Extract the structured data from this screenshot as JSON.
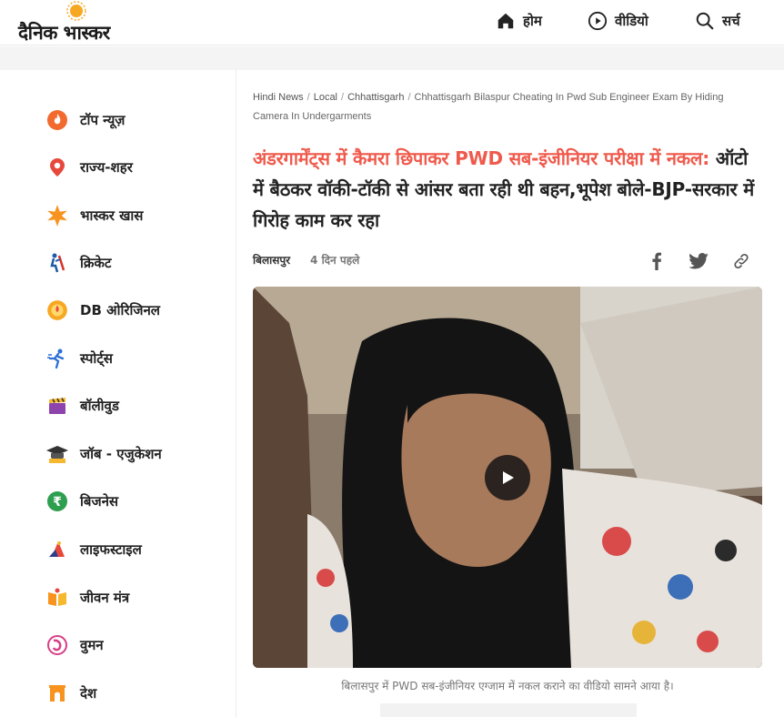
{
  "header": {
    "logo_text": "दैनिक भास्कर",
    "nav": [
      {
        "label": "होम",
        "icon": "home-icon"
      },
      {
        "label": "वीडियो",
        "icon": "play-circle-icon"
      },
      {
        "label": "सर्च",
        "icon": "search-icon"
      }
    ]
  },
  "sidebar": {
    "items": [
      {
        "label": "टॉप न्यूज़",
        "icon": "flame-icon"
      },
      {
        "label": "राज्य-शहर",
        "icon": "location-pin-icon"
      },
      {
        "label": "भास्कर खास",
        "icon": "star-burst-icon"
      },
      {
        "label": "क्रिकेट",
        "icon": "cricket-player-icon"
      },
      {
        "label": "DB ओरिजिनल",
        "icon": "diya-icon"
      },
      {
        "label": "स्पोर्ट्स",
        "icon": "runner-icon"
      },
      {
        "label": "बॉलीवुड",
        "icon": "clapperboard-icon"
      },
      {
        "label": "जॉब - एजुकेशन",
        "icon": "graduation-cap-icon"
      },
      {
        "label": "बिजनेस",
        "icon": "rupee-icon"
      },
      {
        "label": "लाइफस्टाइल",
        "icon": "lifestyle-icon"
      },
      {
        "label": "जीवन मंत्र",
        "icon": "book-icon"
      },
      {
        "label": "वुमन",
        "icon": "woman-icon"
      },
      {
        "label": "देश",
        "icon": "india-gate-icon"
      }
    ]
  },
  "article": {
    "breadcrumb": [
      "Hindi News",
      "Local",
      "Chhattisgarh"
    ],
    "breadcrumb_current": "Chhattisgarh Bilaspur Cheating In Pwd Sub Engineer Exam By Hiding Camera In Undergarments",
    "headline_kicker": "अंडरगार्मेंट्स में कैमरा छिपाकर PWD सब-इंजीनियर परीक्षा में नकल:",
    "headline_rest": " ऑटो में बैठकर वॉकी-टॉकी से आंसर बता रही थी बहन,भूपेश बोले-BJP-सरकार में गिरोह काम कर रहा",
    "city": "बिलासपुर",
    "time": "4 दिन पहले",
    "video_caption": "बिलासपुर में PWD सब-इंजीनियर एग्जाम में नकल कराने का वीडियो सामने आया है।"
  },
  "colors": {
    "kicker": "#ef5a4c",
    "logo_sun": "#f7a823",
    "text": "#222222"
  }
}
